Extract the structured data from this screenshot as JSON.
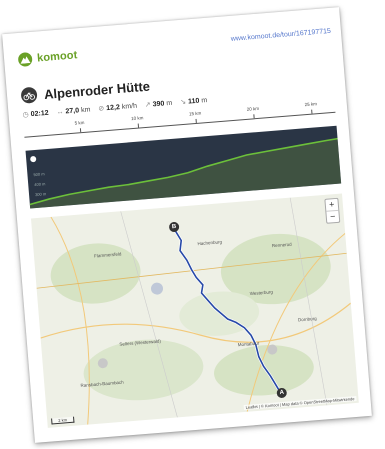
{
  "brand": {
    "name": "komoot"
  },
  "url": "www.komoot.de/tour/167197715",
  "tour": {
    "title": "Alpenroder Hütte"
  },
  "stats": {
    "duration": "02:12",
    "distance": "27,0",
    "distance_unit": "km",
    "speed": "12,2",
    "speed_unit": "km/h",
    "uphill": "390",
    "uphill_unit": "m",
    "downhill": "110",
    "downhill_unit": "m"
  },
  "ruler_ticks": [
    "5 km",
    "10 km",
    "15 km",
    "20 km",
    "25 km"
  ],
  "elevation_labels": [
    "500 m",
    "400 m",
    "300 m"
  ],
  "map": {
    "start_marker": "A",
    "end_marker": "B",
    "attribution": "Leaflet | © Komoot | Map data © OpenStreetMap-Mitwirkende",
    "scale": "2 km",
    "zoom_in": "+",
    "zoom_out": "−",
    "place_labels": [
      "Flammersfeld",
      "Westerburg",
      "Rennerod",
      "Montabaur",
      "Dornburg",
      "Selters (Westerwald)",
      "Ransbach-Baumbach",
      "Hachenburg"
    ]
  },
  "colors": {
    "brand": "#6aa127",
    "route": "#2749a8",
    "profile_bg": "#2a3545",
    "profile_fill": "#5a9a2f"
  }
}
